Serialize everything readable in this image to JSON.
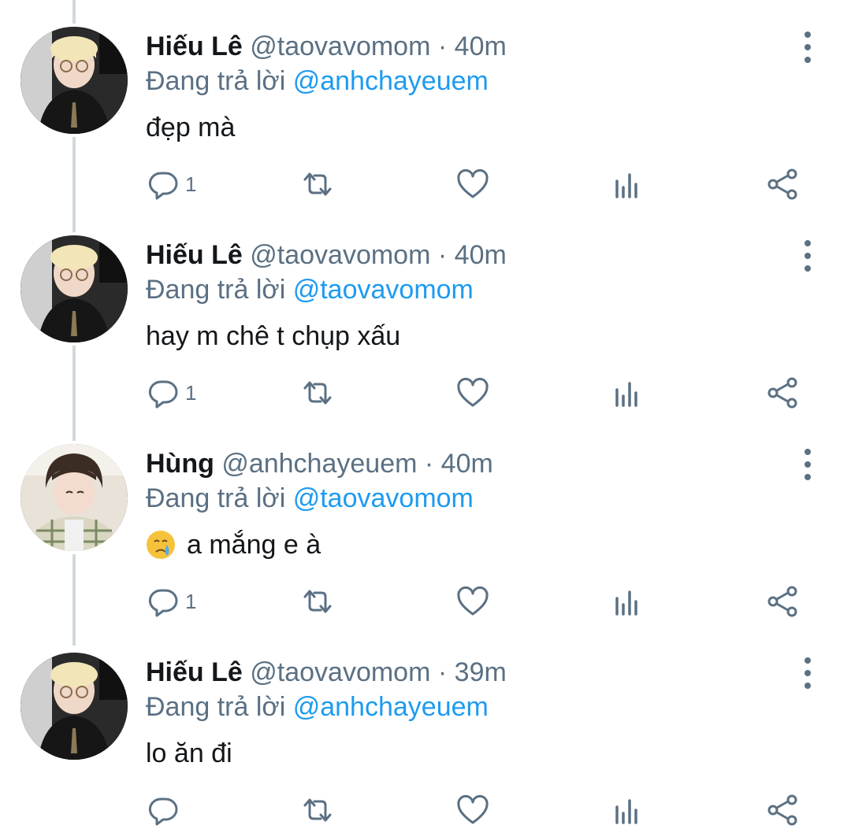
{
  "reply_prefix": "Đang trả lời",
  "tweets": [
    {
      "display_name": "Hiếu Lê",
      "handle": "@taovavomom",
      "separator": "·",
      "time": "40m",
      "reply_to": "@anhchayeuem",
      "text": "đẹp mà",
      "reply_count": "1",
      "avatar_icon": "avatar-hieu-le"
    },
    {
      "display_name": "Hiếu Lê",
      "handle": "@taovavomom",
      "separator": "·",
      "time": "40m",
      "reply_to": "@taovavomom",
      "text": "hay m chê t chụp xấu",
      "reply_count": "1",
      "avatar_icon": "avatar-hieu-le"
    },
    {
      "display_name": "Hùng",
      "handle": "@anhchayeuem",
      "separator": "·",
      "time": "40m",
      "reply_to": "@taovavomom",
      "text": "a mắng e à",
      "emoji": "crying-face-emoji",
      "reply_count": "1",
      "avatar_icon": "avatar-hung"
    },
    {
      "display_name": "Hiếu Lê",
      "handle": "@taovavomom",
      "separator": "·",
      "time": "39m",
      "reply_to": "@anhchayeuem",
      "text": "lo ăn đi",
      "reply_count": "",
      "avatar_icon": "avatar-hieu-le"
    }
  ],
  "colors": {
    "text_primary": "#14171a",
    "text_secondary": "#5b7083",
    "accent": "#1d9bf0",
    "thread_line": "#cfd9de"
  },
  "icons": {
    "reply": "reply-icon",
    "retweet": "retweet-icon",
    "like": "heart-icon",
    "stats": "analytics-icon",
    "share": "share-icon",
    "more": "more-vertical-icon"
  }
}
